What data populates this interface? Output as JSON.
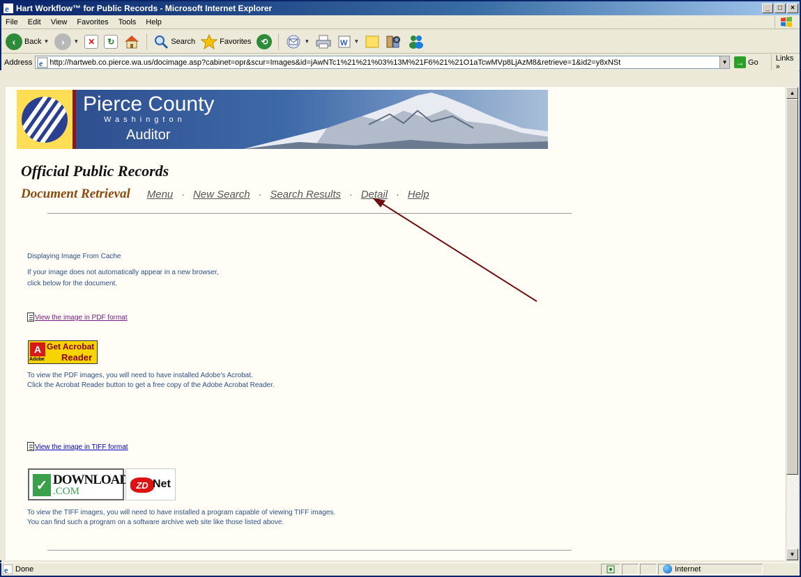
{
  "window": {
    "title": "Hart Workflow™ for Public Records - Microsoft Internet Explorer",
    "controls": {
      "minimize": "_",
      "maximize": "□",
      "close": "×"
    }
  },
  "menu": [
    "File",
    "Edit",
    "View",
    "Favorites",
    "Tools",
    "Help"
  ],
  "toolbar": {
    "back_label": "Back",
    "search_label": "Search",
    "favorites_label": "Favorites"
  },
  "address": {
    "label": "Address",
    "url": "http://hartweb.co.pierce.wa.us/docimage.asp?cabinet=opr&scur=Images&id=jAwNTc1%21%21%03%13M%21F6%21%21O1aTcwMVp8LjAzM8&retrieve=1&id2=y8xNSt",
    "go_label": "Go",
    "links_label": "Links »"
  },
  "banner": {
    "title": "Pierce County",
    "subtitle": "Washington",
    "auditor": "Auditor"
  },
  "page": {
    "title": "Official Public Records",
    "section": "Document Retrieval",
    "nav": [
      "Menu",
      "New Search",
      "Search Results",
      "Detail",
      "Help"
    ],
    "cache_msg": "Displaying Image From Cache",
    "auto_msg_1": "If your image does not automatically appear in a new browser,",
    "auto_msg_2": "click below for the document.",
    "pdf_link": "View the image in PDF format",
    "acrobat": {
      "get": "Get Acrobat",
      "reader": "Reader",
      "adobe": "Adobe"
    },
    "pdf_info_1": "To view the PDF images, you will need to have installed Adobe's Acrobat.",
    "pdf_info_2": "Click the Acrobat Reader button to get a free copy of the Adobe Acrobat Reader.",
    "tiff_link": "View the image in TIFF format",
    "download": {
      "word": "DOWNLOAD",
      "com": ".COM"
    },
    "zdnet": {
      "zd": "ZD",
      "net": "Net"
    },
    "tiff_info_1": "To view the TIFF images, you will need to have installed a program capable of viewing TIFF images.",
    "tiff_info_2": "You can find such a program on a software archive web site like those listed above."
  },
  "status": {
    "text": "Done",
    "zone": "Internet"
  },
  "colors": {
    "titlebar": "#0a246a",
    "link": "#0000cc",
    "visited_link": "#7a1b8a",
    "body_text": "#2b4f8a",
    "section_heading": "#8a4a0e",
    "annotation_arrow": "#6e0f12"
  }
}
